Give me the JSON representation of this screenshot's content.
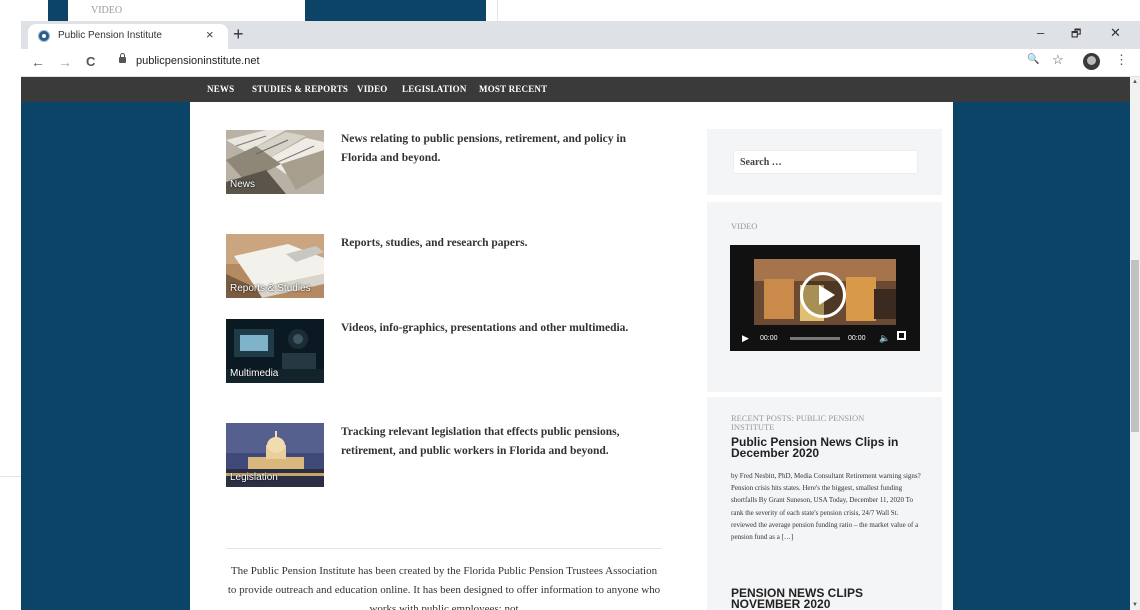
{
  "background_window": {
    "label": "VIDEO"
  },
  "browser": {
    "tab_title": "Public Pension Institute",
    "close_glyph": "×",
    "newtab_glyph": "+",
    "win_min": "–",
    "win_max": "🗗",
    "win_close": "✕",
    "back": "←",
    "forward": "→",
    "reload": "C",
    "url": "publicpensioninstitute.net",
    "zoom_icon": "🔍",
    "star": "☆",
    "menu": "⋮"
  },
  "nav": {
    "items": [
      "NEWS",
      "STUDIES & REPORTS",
      "VIDEO",
      "LEGISLATION",
      "MOST RECENT"
    ]
  },
  "main": {
    "entries": [
      {
        "caption": "News",
        "text": "News relating to public pensions, retirement, and policy in Florida and beyond."
      },
      {
        "caption": "Reports & Studies",
        "text": "Reports, studies, and research papers."
      },
      {
        "caption": "Multimedia",
        "text": "Videos, info-graphics, presentations and other multimedia."
      },
      {
        "caption": "Legislation",
        "text": "Tracking relevant legislation that effects public pensions, retirement, and public workers in Florida and beyond."
      }
    ],
    "about": "The Public Pension Institute has been created by the Florida Public Pension Trustees Association to provide outreach and education online. It has been designed to offer information to anyone who works with public employees; not"
  },
  "sidebar": {
    "search_placeholder": "Search …",
    "video_label": "VIDEO",
    "video_time_current": "00:00",
    "video_time_total": "00:00",
    "recent_label": "RECENT POSTS: PUBLIC PENSION INSTITUTE",
    "posts": [
      {
        "title": "Public Pension News Clips in December 2020",
        "excerpt": "by Fred Nesbitt, PhD, Media Consultant Retirement warning signs? Pension crisis hits states. Here's the biggest, smallest funding shortfalls By Grant Suneson, USA Today, December 11, 2020 To rank the severity of each state's pension crisis, 24/7 Wall St. reviewed the average pension funding ratio – the market value of a pension fund as a […]"
      },
      {
        "title": "PENSION NEWS CLIPS NOVEMBER 2020",
        "excerpt": ""
      }
    ]
  },
  "colors": {
    "navy": "#0b4466",
    "nav_bg": "#3a3a3a",
    "sidebar_bg": "#f4f5f7"
  }
}
